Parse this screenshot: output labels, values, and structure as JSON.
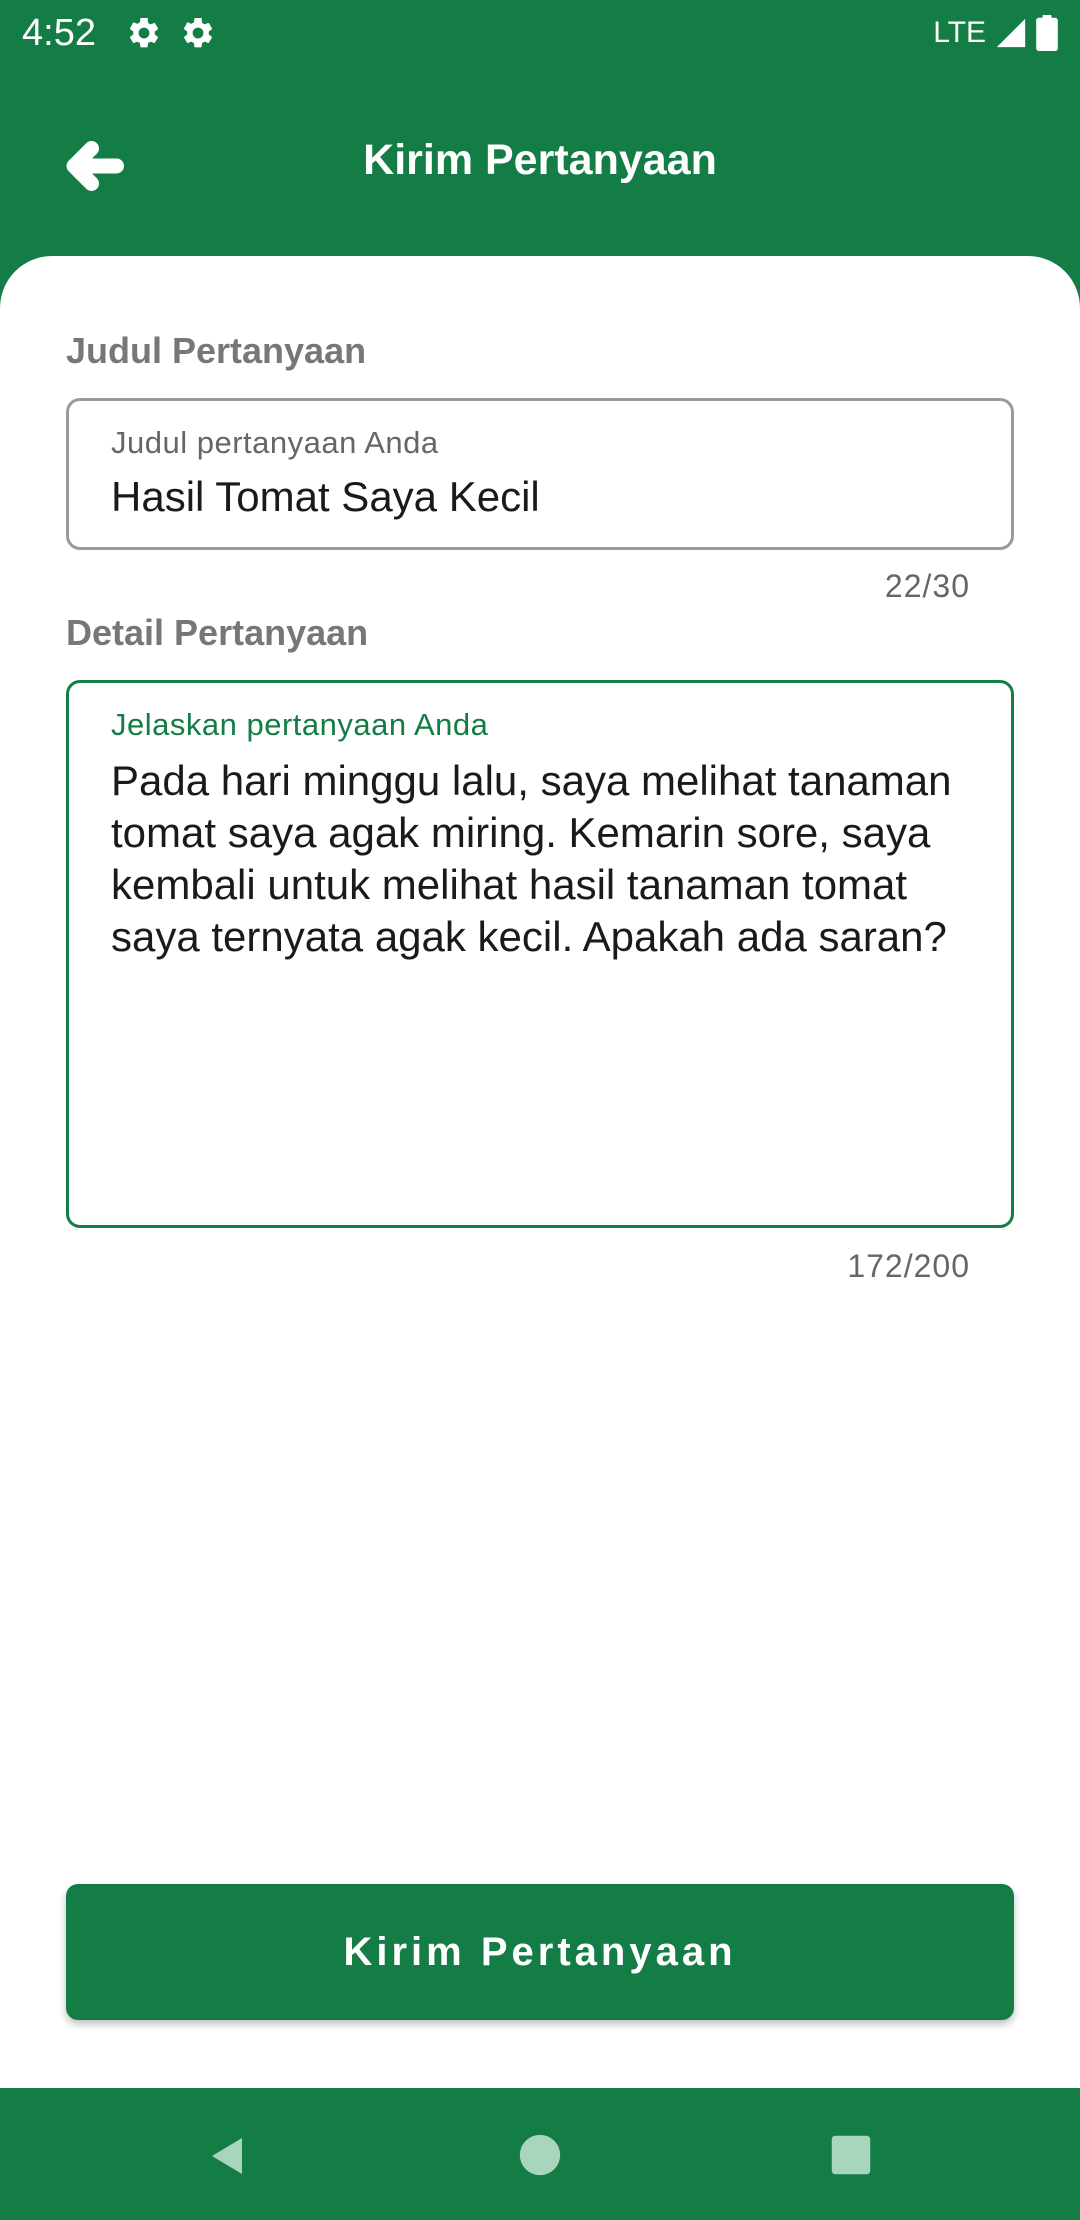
{
  "status_bar": {
    "time": "4:52",
    "network": "LTE",
    "icons": [
      "gear-icon",
      "gear-icon",
      "signal-icon",
      "battery-icon"
    ]
  },
  "app_bar": {
    "title": "Kirim Pertanyaan",
    "back_icon": "arrow-left-icon"
  },
  "form": {
    "title_section_label": "Judul Pertanyaan",
    "title_field": {
      "floating_label": "Judul pertanyaan Anda",
      "value": "Hasil Tomat Saya Kecil",
      "counter": "22/30"
    },
    "detail_section_label": "Detail Pertanyaan",
    "detail_field": {
      "floating_label": "Jelaskan pertanyaan Anda",
      "value": "Pada hari minggu lalu, saya melihat tanaman tomat saya agak miring. Kemarin sore, saya kembali untuk melihat hasil tanaman tomat saya ternyata agak kecil. Apakah ada saran?",
      "counter": "172/200"
    },
    "submit_label": "Kirim Pertanyaan"
  },
  "nav_bar": {
    "icons": [
      "nav-back-icon",
      "nav-home-icon",
      "nav-recents-icon"
    ]
  },
  "colors": {
    "primary": "#137d45",
    "label_gray": "#777777",
    "text": "#1a1a1a",
    "surface": "#ffffff"
  }
}
